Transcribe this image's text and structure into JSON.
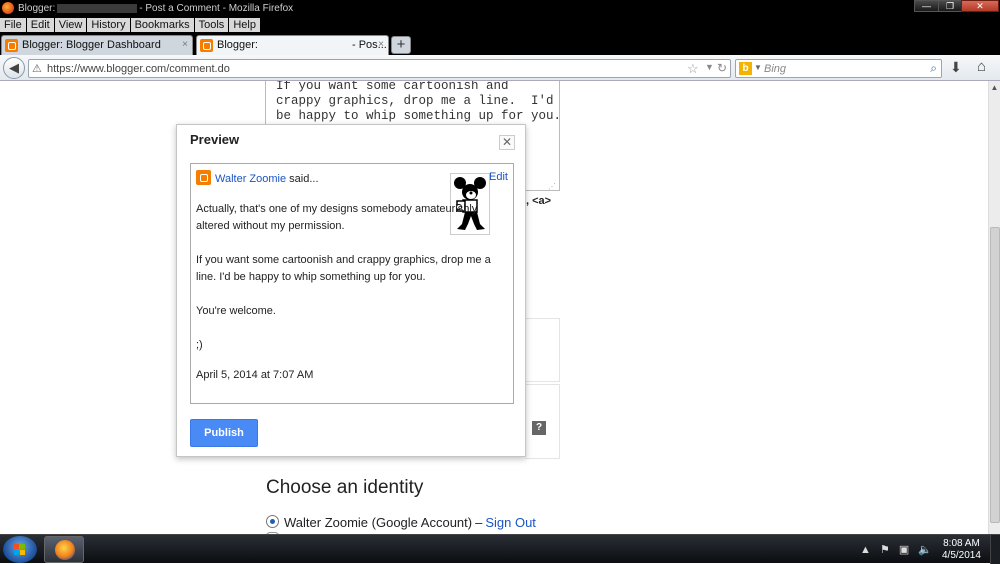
{
  "window": {
    "title_prefix": "Blogger:",
    "title_suffix": "- Post a Comment - Mozilla Firefox",
    "minimize": "—",
    "maximize": "❐",
    "close": "✕"
  },
  "menu": [
    "File",
    "Edit",
    "View",
    "History",
    "Bookmarks",
    "Tools",
    "Help"
  ],
  "tabs": [
    {
      "label": "Blogger: Blogger Dashboard",
      "close": "×"
    },
    {
      "label": "Blogger:",
      "suffix": "- Pos...",
      "close": "×"
    }
  ],
  "new_tab": "+",
  "nav": {
    "back": "◀",
    "url": "https://www.blogger.com/comment.do",
    "search_placeholder": "Bing",
    "bing": "b"
  },
  "page": {
    "textarea_text": "If you want some cartoonish and\ncrappy graphics, drop me a line.  I'd\nbe happy to whip something up for you.",
    "tags_hint": ", <a>",
    "help": "?",
    "identity_title": "Choose an identity",
    "identity_option": "Walter Zoomie (Google Account)",
    "identity_dash": "–",
    "sign_out": "Sign Out"
  },
  "preview": {
    "title": "Preview",
    "close": "✕",
    "author": "Walter Zoomie",
    "said": "said...",
    "edit": "Edit",
    "paragraphs": [
      "Actually, that's one of my designs somebody amateurishly altered without my permission.",
      "If you want some cartoonish and crappy graphics, drop me a line. I'd be happy to whip something up for you.",
      "You're welcome.",
      ";)"
    ],
    "date": "April 5, 2014 at 7:07 AM",
    "publish": "Publish"
  },
  "taskbar": {
    "time": "8:08 AM",
    "date": "4/5/2014"
  },
  "colors": {
    "link": "#1a55c5",
    "publish": "#4a8af4",
    "blogger": "#f57d00"
  }
}
